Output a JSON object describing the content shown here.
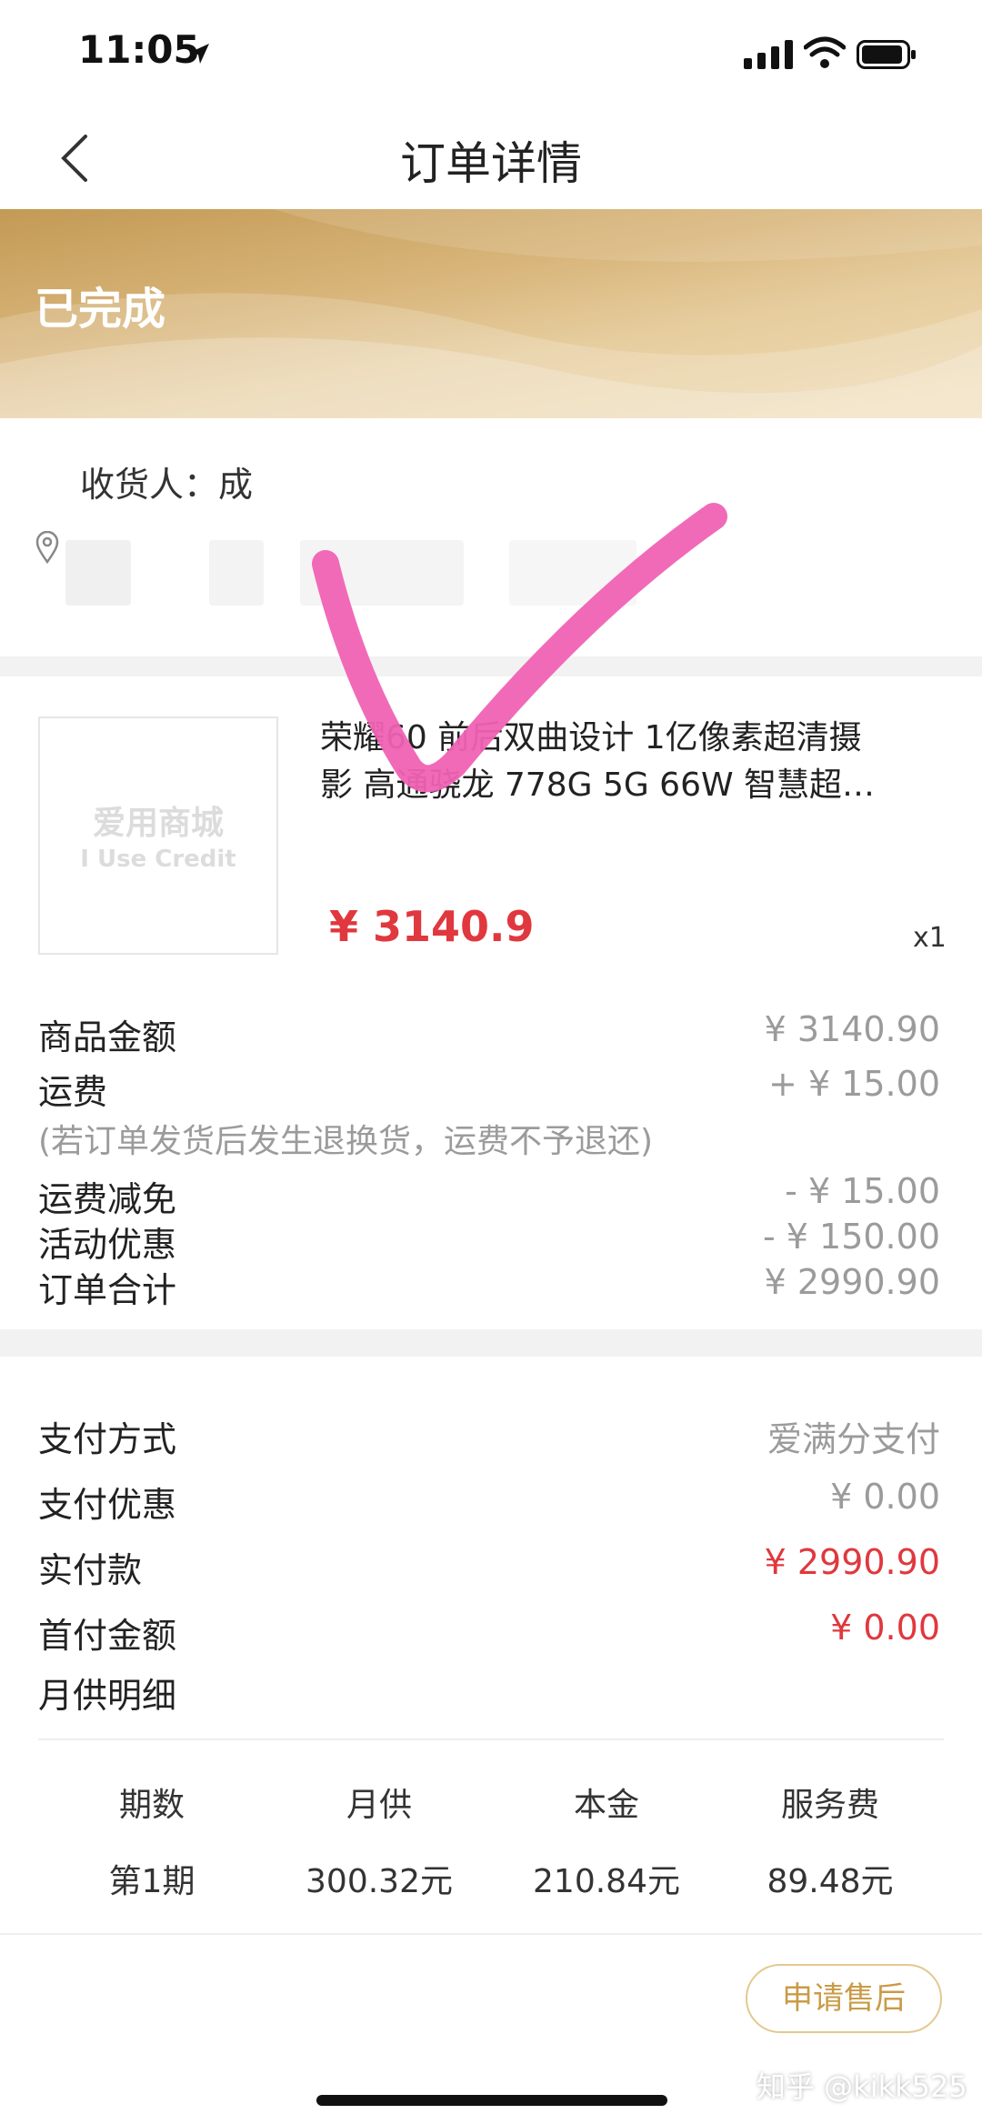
{
  "status_bar": {
    "time": "11:05"
  },
  "nav": {
    "title": "订单详情"
  },
  "banner": {
    "status": "已完成"
  },
  "receiver": {
    "label": "收货人：成"
  },
  "product": {
    "logo_cn": "爱用商城",
    "logo_en": "I Use Credit",
    "title_line1": "荣耀60 前后双曲设计 1亿像素超清摄",
    "title_line2": "影 高通骁龙 778G 5G 66W 智慧超…",
    "price": "¥ 3140.9",
    "quantity": "x1"
  },
  "fees": {
    "goods_amount": {
      "label": "商品金额",
      "value": "¥ 3140.90"
    },
    "shipping": {
      "label": "运费",
      "value": "+ ¥ 15.00"
    },
    "shipping_note": "(若订单发货后发生退换货，运费不予退还)",
    "shipping_waiver": {
      "label": "运费减免",
      "value": "- ¥ 15.00"
    },
    "promotion": {
      "label": "活动优惠",
      "value": "- ¥ 150.00"
    },
    "order_total": {
      "label": "订单合计",
      "value": "¥ 2990.90"
    }
  },
  "payment": {
    "method": {
      "label": "支付方式",
      "value": "爱满分支付"
    },
    "discount": {
      "label": "支付优惠",
      "value": "¥ 0.00"
    },
    "paid": {
      "label": "实付款",
      "value": "¥ 2990.90"
    },
    "down_payment": {
      "label": "首付金额",
      "value": "¥ 0.00"
    },
    "monthly_detail_label": "月供明细"
  },
  "schedule": {
    "headers": [
      "期数",
      "月供",
      "本金",
      "服务费"
    ],
    "rows": [
      [
        "第1期",
        "300.32元",
        "210.84元",
        "89.48元"
      ]
    ]
  },
  "footer": {
    "after_sale_button": "申请售后",
    "watermark": "知乎 @kikk525"
  },
  "colors": {
    "accent_red": "#e0383e",
    "gold": "#c99b47",
    "check_pink": "#f062b4"
  }
}
